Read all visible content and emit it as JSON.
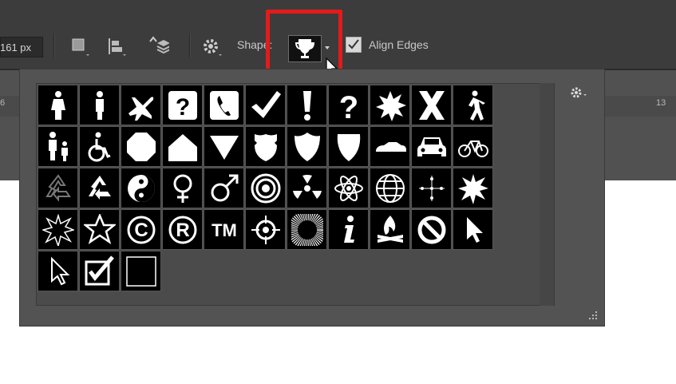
{
  "options_bar": {
    "width_value": "161 px",
    "shape_label": "Shape:",
    "align_edges_label": "Align Edges",
    "align_edges_checked": true,
    "current_shape_icon": "trophy-icon"
  },
  "ruler": {
    "left_number": "6",
    "right_number": "13"
  },
  "shape_panel": {
    "rows": [
      [
        "woman-icon",
        "man-icon",
        "airplane-icon",
        "question-box-icon",
        "phone-icon",
        "checkmark-icon",
        "exclamation-icon",
        "question-icon",
        "burst-icon",
        "x-mark-icon",
        "pedestrian-icon"
      ],
      [
        "parent-child-icon",
        "wheelchair-icon",
        "octagon-icon",
        "house-icon",
        "yield-icon",
        "police-badge-icon",
        "shield-icon",
        "shield-plain-icon",
        "car-side-icon",
        "car-front-icon",
        "bicycle-icon"
      ],
      [
        "recycle-outline-icon",
        "recycle-icon",
        "yin-yang-icon",
        "female-symbol-icon",
        "male-symbol-icon",
        "target-icon",
        "radiation-icon",
        "atom-icon",
        "globe-icon",
        "crosshair-dots-icon",
        "explosion-icon"
      ],
      [
        "explosion-outline-icon",
        "star-outline-icon",
        "copyright-icon",
        "registered-icon",
        "trademark-icon",
        "crosshair-icon",
        "starburst-circle-icon",
        "info-icon",
        "campfire-icon",
        "no-symbol-icon",
        "arrow-cursor-icon"
      ],
      [
        "arrow-cursor-outline-icon",
        "checkbox-checked-icon",
        "empty-square-icon"
      ]
    ]
  }
}
